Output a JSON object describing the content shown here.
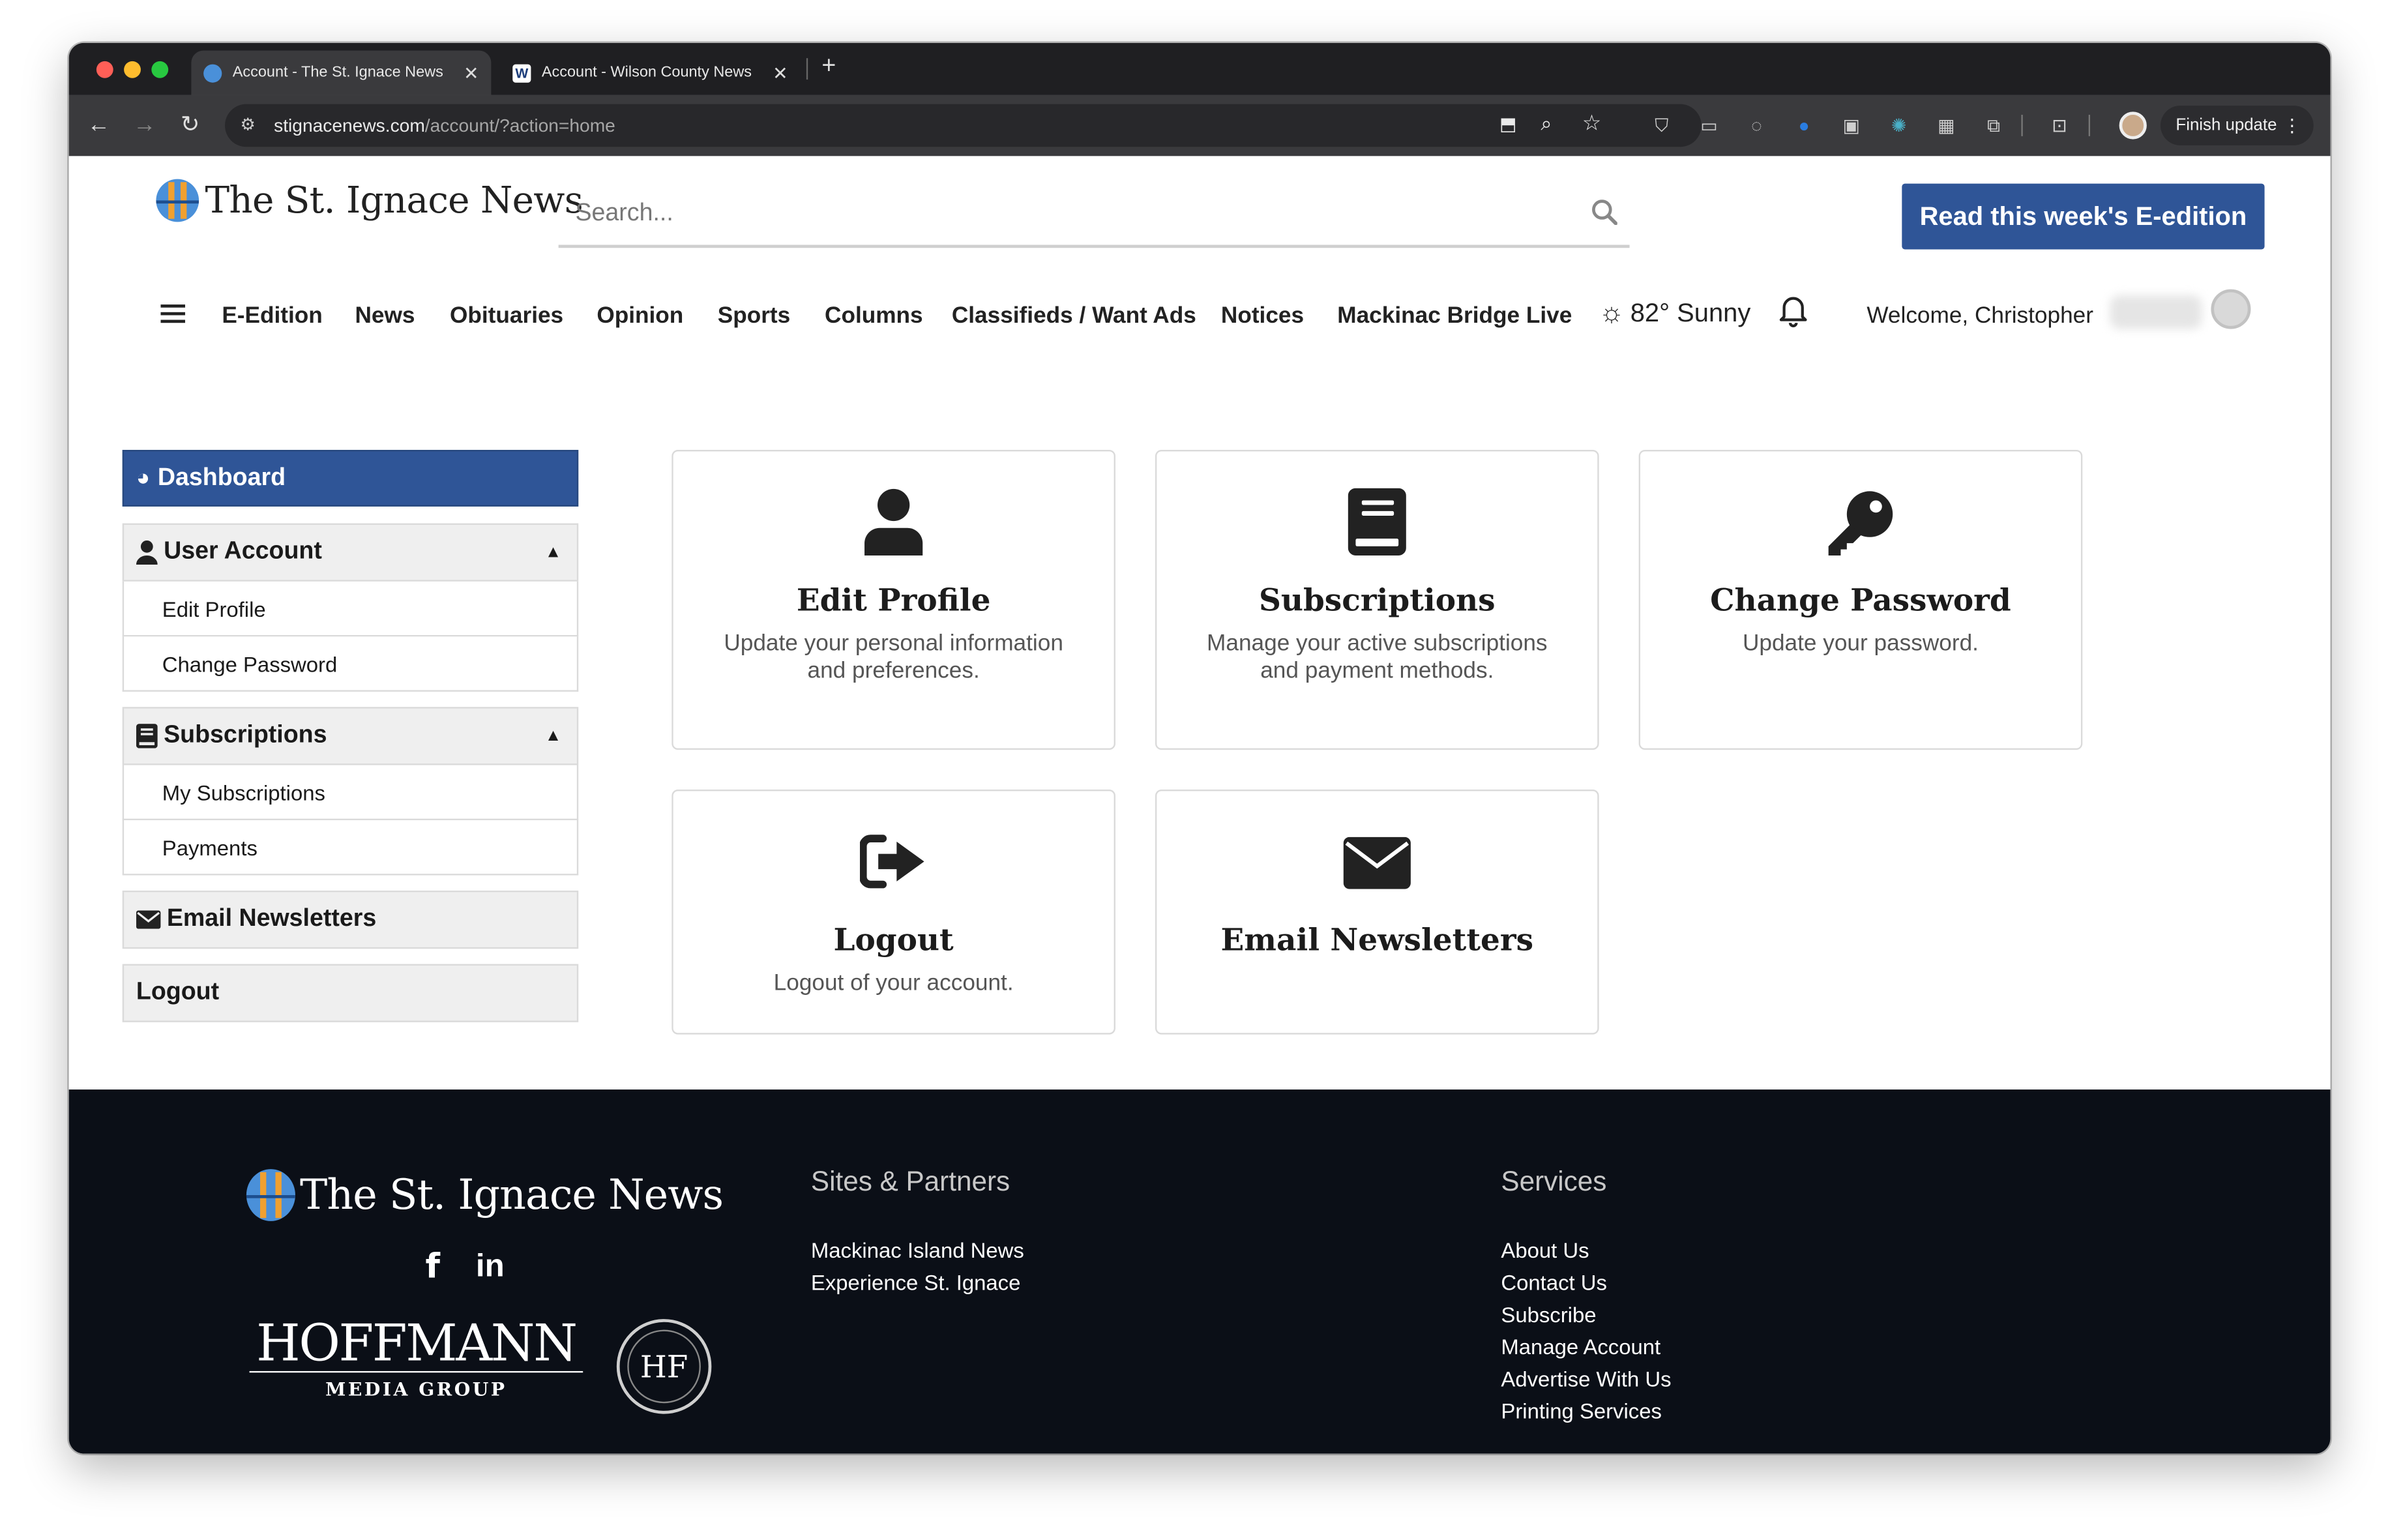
{
  "browser": {
    "tabs": [
      {
        "title": "Account - The St. Ignace News",
        "favicon": "globe-favicon",
        "active": true
      },
      {
        "title": "Account - Wilson County News",
        "favicon": "W",
        "active": false
      }
    ],
    "new_tab": "+",
    "url_domain": "stignacenews.com",
    "url_path": "/account/?action=home",
    "finish_update": "Finish update"
  },
  "site": {
    "logo_text": "The St. Ignace News",
    "search_placeholder": "Search...",
    "cta": "Read this week's E-edition"
  },
  "nav": {
    "items": [
      "E-Edition",
      "News",
      "Obituaries",
      "Opinion",
      "Sports",
      "Columns",
      "Classifieds / Want Ads",
      "Notices",
      "Mackinac Bridge Live"
    ],
    "weather": "82° Sunny",
    "welcome": "Welcome, Christopher"
  },
  "sidebar": {
    "dashboard": "Dashboard",
    "user_account": "User Account",
    "edit_profile": "Edit Profile",
    "change_password": "Change Password",
    "subscriptions": "Subscriptions",
    "my_subscriptions": "My Subscriptions",
    "payments": "Payments",
    "email_newsletters": "Email Newsletters",
    "logout": "Logout"
  },
  "cards": {
    "edit_profile": {
      "title": "Edit Profile",
      "desc": "Update your personal information and preferences."
    },
    "subscriptions": {
      "title": "Subscriptions",
      "desc": "Manage your active subscriptions and payment methods."
    },
    "change_password": {
      "title": "Change Password",
      "desc": "Update your password."
    },
    "logout": {
      "title": "Logout",
      "desc": "Logout of your account."
    },
    "email_newsletters": {
      "title": "Email Newsletters"
    }
  },
  "footer": {
    "logo_text": "The St. Ignace News",
    "hoffmann": "HOFFMANN",
    "media_group": "MEDIA GROUP",
    "hf": "HF",
    "sites_heading": "Sites & Partners",
    "sites": [
      "Mackinac Island News",
      "Experience St. Ignace"
    ],
    "services_heading": "Services",
    "services": [
      "About Us",
      "Contact Us",
      "Subscribe",
      "Manage Account",
      "Advertise With Us",
      "Printing Services"
    ]
  },
  "colors": {
    "brand_blue": "#2f5597",
    "footer_bg": "#0b0f17"
  }
}
